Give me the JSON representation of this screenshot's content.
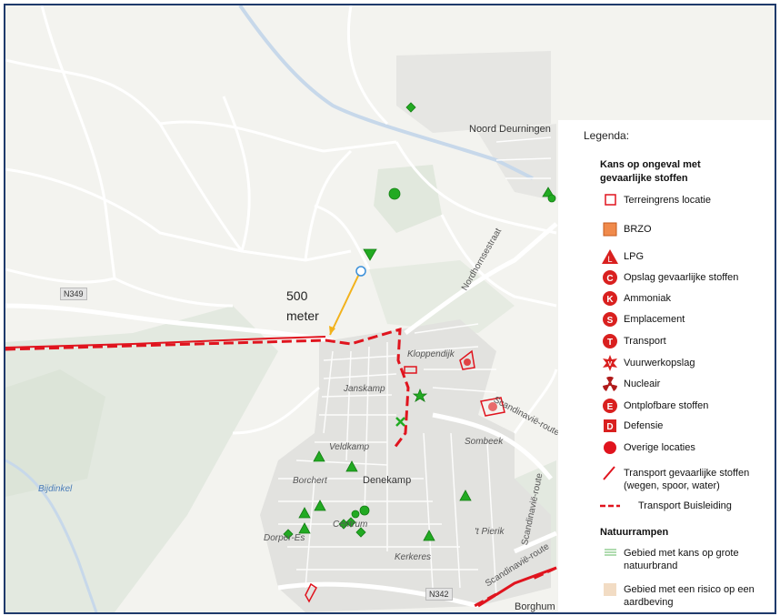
{
  "map": {
    "place_labels": {
      "noord_deurningen": "Noord Deurningen",
      "kloppendijk": "Kloppendijk",
      "janskamp": "Janskamp",
      "veldkamp": "Veldkamp",
      "borchert": "Borchert",
      "denekamp": "Denekamp",
      "centrum": "Centrum",
      "dorper_es": "Dorper-Es",
      "kerkeres": "Kerkeres",
      "sombeek": "Sombeek",
      "t_pierik": "'t Pierik",
      "bijdinkel": "Bijdinkel",
      "borghum": "Borghum",
      "nordhornsestraat": "Nordhornsestraat",
      "scandinavie_route_1": "Scandinavië-route",
      "scandinavie_route_2": "Scandinavië-route",
      "scandinavie_route_3": "Scandinavië-route"
    },
    "road_badges": {
      "n349": "N349",
      "n342": "N342"
    },
    "distance_label": {
      "line1": "500",
      "line2": "meter"
    },
    "colors": {
      "hazard_green": "#22aa22",
      "pipeline_red": "#e0141e",
      "distance_line": "#f2b21c",
      "marker_blue": "#3a8fd9",
      "brzo_orange": "#f08a4b"
    }
  },
  "legend": {
    "title": "Legenda:",
    "section_hazardous": "Kans op ongeval met gevaarlijke stoffen",
    "items": [
      {
        "icon": "square-outline-icon",
        "label": "Terreingrens locatie"
      },
      {
        "icon": "filled-square-icon",
        "label": "BRZO"
      },
      {
        "icon": "lpg-triangle-icon",
        "label": "LPG"
      },
      {
        "icon": "opslag-c-icon",
        "label": "Opslag gevaarlijke stoffen"
      },
      {
        "icon": "ammoniak-k-icon",
        "label": "Ammoniak"
      },
      {
        "icon": "emplacement-s-icon",
        "label": "Emplacement"
      },
      {
        "icon": "transport-t-icon",
        "label": "Transport"
      },
      {
        "icon": "vuurwerk-v-icon",
        "label": "Vuurwerkopslag"
      },
      {
        "icon": "nuclear-icon",
        "label": "Nucleair"
      },
      {
        "icon": "explosive-e-icon",
        "label": "Ontplofbare stoffen"
      },
      {
        "icon": "defensie-d-icon",
        "label": "Defensie"
      },
      {
        "icon": "red-circle-icon",
        "label": "Overige locaties"
      },
      {
        "icon": "red-line-icon",
        "label": "Transport gevaarlijke stoffen (wegen, spoor, water)"
      },
      {
        "icon": "dashed-line-icon",
        "label": "Transport Buisleiding"
      }
    ],
    "section_nature": "Natuurrampen",
    "nature_items": [
      {
        "icon": "green-hatch-icon",
        "label": "Gebied met kans op grote natuurbrand"
      },
      {
        "icon": "beige-square-icon",
        "label": "Gebied met een risico op een aardbeving"
      }
    ]
  }
}
